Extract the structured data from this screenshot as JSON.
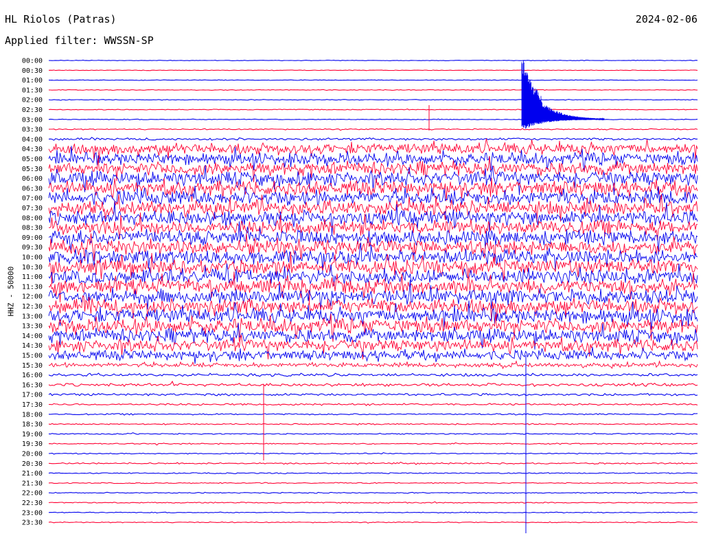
{
  "header": {
    "station": "HL Riolos (Patras)",
    "filter": "Applied filter: WWSSN-SP",
    "date": "2024-02-06"
  },
  "chart_data": {
    "type": "line",
    "ylabel": "HHZ - 50000",
    "colors": [
      "#0000ee",
      "#ff0033"
    ],
    "traces": [
      {
        "label": "00:00",
        "amp": 0.5
      },
      {
        "label": "00:30",
        "amp": 0.5
      },
      {
        "label": "01:00",
        "amp": 0.5
      },
      {
        "label": "01:30",
        "amp": 0.6
      },
      {
        "label": "02:00",
        "amp": 0.6
      },
      {
        "label": "02:30",
        "amp": 0.6
      },
      {
        "label": "03:00",
        "amp": 0.7
      },
      {
        "label": "03:30",
        "amp": 1.0
      },
      {
        "label": "04:00",
        "amp": 2.0
      },
      {
        "label": "04:30",
        "amp": 9
      },
      {
        "label": "05:00",
        "amp": 10
      },
      {
        "label": "05:30",
        "amp": 11
      },
      {
        "label": "06:00",
        "amp": 12
      },
      {
        "label": "06:30",
        "amp": 12
      },
      {
        "label": "07:00",
        "amp": 12
      },
      {
        "label": "07:30",
        "amp": 12
      },
      {
        "label": "08:00",
        "amp": 12
      },
      {
        "label": "08:30",
        "amp": 12
      },
      {
        "label": "09:00",
        "amp": 12
      },
      {
        "label": "09:30",
        "amp": 12
      },
      {
        "label": "10:00",
        "amp": 12
      },
      {
        "label": "10:30",
        "amp": 12
      },
      {
        "label": "11:00",
        "amp": 12
      },
      {
        "label": "11:30",
        "amp": 12
      },
      {
        "label": "12:00",
        "amp": 12
      },
      {
        "label": "12:30",
        "amp": 12
      },
      {
        "label": "13:00",
        "amp": 12
      },
      {
        "label": "13:30",
        "amp": 12
      },
      {
        "label": "14:00",
        "amp": 11
      },
      {
        "label": "14:30",
        "amp": 10
      },
      {
        "label": "15:00",
        "amp": 8
      },
      {
        "label": "15:30",
        "amp": 3.5
      },
      {
        "label": "16:00",
        "amp": 2.5
      },
      {
        "label": "16:30",
        "amp": 2.5
      },
      {
        "label": "17:00",
        "amp": 2.0
      },
      {
        "label": "17:30",
        "amp": 1.6
      },
      {
        "label": "18:00",
        "amp": 1.2
      },
      {
        "label": "18:30",
        "amp": 1.0
      },
      {
        "label": "19:00",
        "amp": 1.0
      },
      {
        "label": "19:30",
        "amp": 1.0
      },
      {
        "label": "20:00",
        "amp": 0.9
      },
      {
        "label": "20:30",
        "amp": 1.2
      },
      {
        "label": "21:00",
        "amp": 0.9
      },
      {
        "label": "21:30",
        "amp": 0.9
      },
      {
        "label": "22:00",
        "amp": 0.9
      },
      {
        "label": "22:30",
        "amp": 0.9
      },
      {
        "label": "23:00",
        "amp": 0.8
      },
      {
        "label": "23:30",
        "amp": 0.8
      }
    ]
  }
}
